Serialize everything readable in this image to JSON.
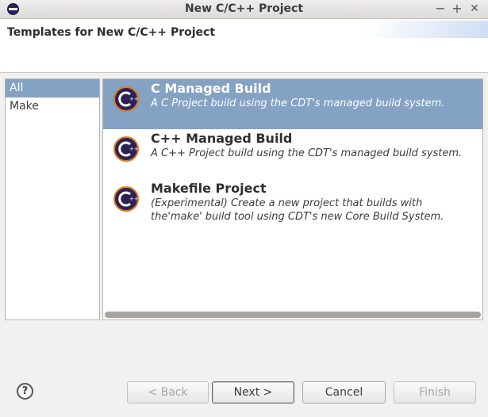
{
  "window": {
    "title": "New C/C++ Project",
    "controls": {
      "minimize": "−",
      "maximize": "+",
      "close": "✕"
    }
  },
  "header": {
    "title": "Templates for New C/C++ Project"
  },
  "categories": [
    {
      "label": "All",
      "selected": true
    },
    {
      "label": "Make",
      "selected": false
    }
  ],
  "templates": [
    {
      "name": "C Managed Build",
      "description": "A C Project build using the CDT's managed build system.",
      "selected": true,
      "icon": "cdt-c-icon"
    },
    {
      "name": "C++ Managed Build",
      "description": "A C++ Project build using the CDT's managed build system.",
      "selected": false,
      "icon": "cdt-cpp-icon"
    },
    {
      "name": "Makefile Project",
      "description": "(Experimental) Create a new project that builds with the'make' build tool using CDT's new Core Build System.",
      "selected": false,
      "icon": "cdt-cpp-icon"
    }
  ],
  "footer": {
    "help": "?",
    "back_label": "< Back",
    "next_label": "Next >",
    "cancel_label": "Cancel",
    "finish_label": "Finish"
  },
  "colors": {
    "selection": "#84a2c4",
    "dialog_bg": "#f2f1f0",
    "icon_dark": "#2c2255"
  }
}
